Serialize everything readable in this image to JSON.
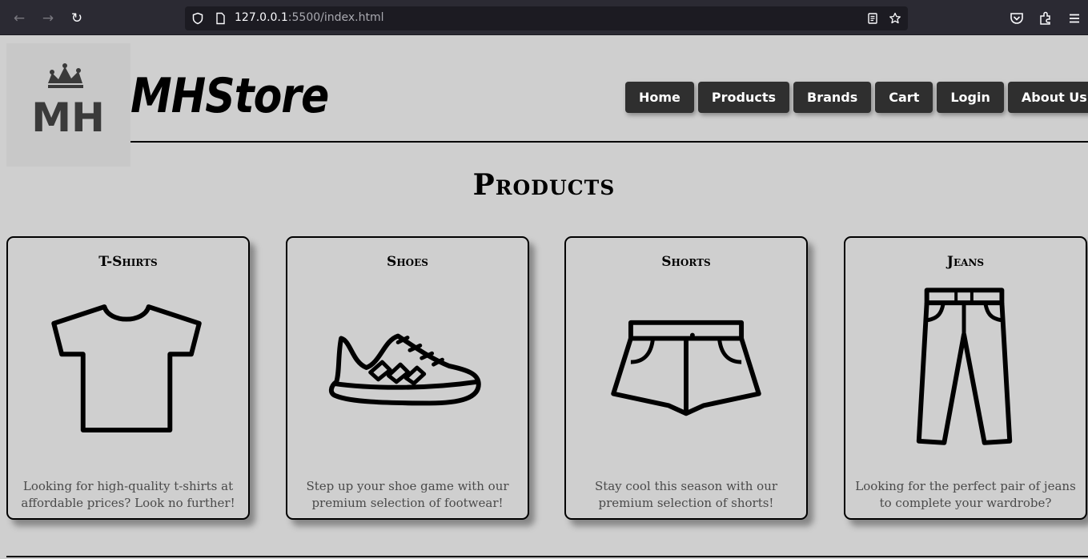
{
  "browser": {
    "url_host": "127.0.0.1",
    "url_rest": ":5500/index.html"
  },
  "site": {
    "logo_text": "MH",
    "brand": "MHStore",
    "nav": [
      "Home",
      "Products",
      "Brands",
      "Cart",
      "Login",
      "About Us"
    ]
  },
  "products": {
    "title": "Products",
    "cards": [
      {
        "title": "T-Shirts",
        "icon": "t-shirt-icon",
        "desc_line1": "Looking for high-quality t-shirts at",
        "desc_line2": "affordable prices? Look no further!"
      },
      {
        "title": "Shoes",
        "icon": "shoe-icon",
        "desc_line1": "Step up your shoe game with our",
        "desc_line2": "premium selection of footwear!"
      },
      {
        "title": "Shorts",
        "icon": "shorts-icon",
        "desc_line1": "Stay cool this season with our",
        "desc_line2": "premium selection of shorts!"
      },
      {
        "title": "Jeans",
        "icon": "jeans-icon",
        "desc_line1": "Looking for the perfect pair of jeans",
        "desc_line2": "to complete your wardrobe?"
      }
    ]
  }
}
